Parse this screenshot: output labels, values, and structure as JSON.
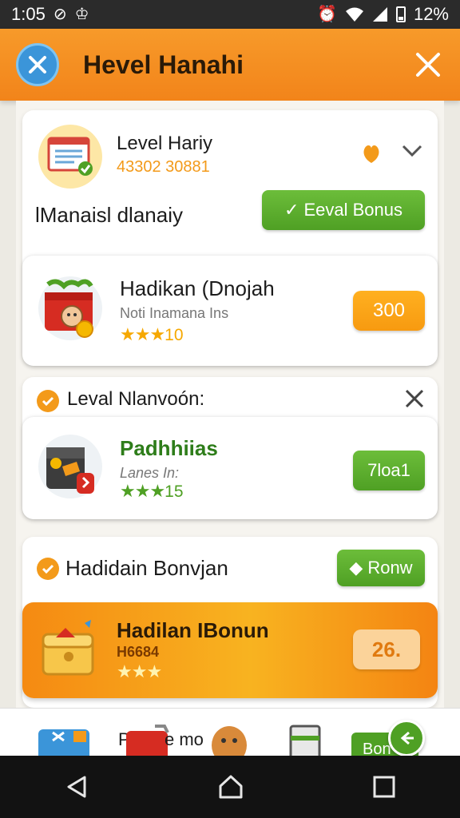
{
  "status_bar": {
    "time": "1:05",
    "battery": "12%"
  },
  "header": {
    "title": "Hevel Hanahi"
  },
  "level_card": {
    "title": "Level Hariy",
    "code": "43302 30881",
    "subtitle": "lManaisl dlanaiy",
    "button_label": "Eeval Bonus"
  },
  "item_1": {
    "title": "Hadikan (Dnojah",
    "subtitle": "Noti Inamana Ins",
    "rating": "10",
    "price": "300"
  },
  "section_2": {
    "title": "Leval Nlanvoón:"
  },
  "item_2": {
    "title": "Padhhiias",
    "subtitle": "Lanes In:",
    "rating": "15",
    "button_label": "7loa1"
  },
  "section_3": {
    "title": "Hadidain Bonvjan",
    "button_label": "Ronw"
  },
  "featured": {
    "title": "Hadilan IBonun",
    "subtitle": "H6684",
    "price": "26."
  },
  "bottom_nav": {
    "label_1": "Pi",
    "label_2": "e mo",
    "label_3": "Bon"
  },
  "colors": {
    "accent_orange": "#f2841a",
    "accent_green": "#4fa024",
    "close_blue": "#3b95d9"
  }
}
